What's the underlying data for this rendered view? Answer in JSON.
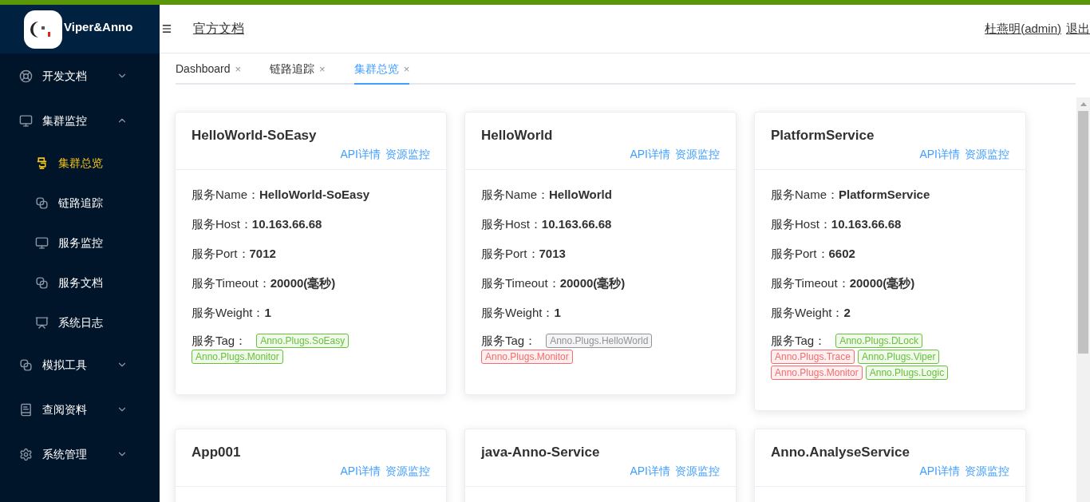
{
  "brand": {
    "name": "Viper&Anno"
  },
  "header": {
    "doc_link": "官方文档",
    "user": "杜燕明(admin)",
    "logout": "退出"
  },
  "sidebar": {
    "items": [
      {
        "label": "开发文档",
        "kind": "lifebuoy",
        "expanded": false,
        "selected": false
      },
      {
        "label": "集群监控",
        "kind": "monitor",
        "expanded": true,
        "selected": false,
        "children": [
          {
            "label": "集群总览",
            "kind": "cluster",
            "selected": true
          },
          {
            "label": "链路追踪",
            "kind": "link",
            "selected": false
          },
          {
            "label": "服务监控",
            "kind": "monitor",
            "selected": false
          },
          {
            "label": "服务文档",
            "kind": "link",
            "selected": false
          },
          {
            "label": "系统日志",
            "kind": "board",
            "selected": false
          }
        ]
      },
      {
        "label": "模拟工具",
        "kind": "link",
        "expanded": false,
        "selected": false
      },
      {
        "label": "查阅资料",
        "kind": "book",
        "expanded": false,
        "selected": false
      },
      {
        "label": "系统管理",
        "kind": "gear",
        "expanded": false,
        "selected": false
      }
    ]
  },
  "tabs": [
    {
      "label": "Dashboard",
      "close": "×",
      "selected": false
    },
    {
      "label": "链路追踪",
      "close": "×",
      "selected": false
    },
    {
      "label": "集群总览",
      "close": "×",
      "selected": true
    }
  ],
  "cards": [
    {
      "title": "HelloWorld-SoEasy",
      "links": [
        "API详情",
        "资源监控"
      ],
      "fields": [
        {
          "label": "服务Name：",
          "value": "HelloWorld-SoEasy"
        },
        {
          "label": "服务Host：",
          "value": "10.163.66.68"
        },
        {
          "label": "服务Port：",
          "value": "7012"
        },
        {
          "label": "服务Timeout：",
          "value": "20000(毫秒)"
        },
        {
          "label": "服务Weight：",
          "value": "1"
        }
      ],
      "tag_label": "服务Tag：",
      "tags": [
        {
          "text": "Anno.Plugs.SoEasy",
          "kind": "success"
        },
        {
          "text": "Anno.Plugs.Monitor",
          "kind": "success"
        }
      ]
    },
    {
      "title": "HelloWorld",
      "links": [
        "API详情",
        "资源监控"
      ],
      "fields": [
        {
          "label": "服务Name：",
          "value": "HelloWorld"
        },
        {
          "label": "服务Host：",
          "value": "10.163.66.68"
        },
        {
          "label": "服务Port：",
          "value": "7013"
        },
        {
          "label": "服务Timeout：",
          "value": "20000(毫秒)"
        },
        {
          "label": "服务Weight：",
          "value": "1"
        }
      ],
      "tag_label": "服务Tag：",
      "tags": [
        {
          "text": "Anno.Plugs.HelloWorld",
          "kind": "info"
        },
        {
          "text": "Anno.Plugs.Monitor",
          "kind": "danger"
        }
      ]
    },
    {
      "title": "PlatformService",
      "links": [
        "API详情",
        "资源监控"
      ],
      "fields": [
        {
          "label": "服务Name：",
          "value": "PlatformService"
        },
        {
          "label": "服务Host：",
          "value": "10.163.66.68"
        },
        {
          "label": "服务Port：",
          "value": "6602"
        },
        {
          "label": "服务Timeout：",
          "value": "20000(毫秒)"
        },
        {
          "label": "服务Weight：",
          "value": "2"
        }
      ],
      "tag_label": "服务Tag：",
      "tags": [
        {
          "text": "Anno.Plugs.DLock",
          "kind": "success"
        },
        {
          "text": "Anno.Plugs.Trace",
          "kind": "danger"
        },
        {
          "text": "Anno.Plugs.Viper",
          "kind": "success"
        },
        {
          "text": "Anno.Plugs.Monitor",
          "kind": "danger"
        },
        {
          "text": "Anno.Plugs.Logic",
          "kind": "success"
        }
      ]
    },
    {
      "title": "App001",
      "links": [
        "API详情",
        "资源监控"
      ]
    },
    {
      "title": "java-Anno-Service",
      "links": [
        "API详情",
        "资源监控"
      ]
    },
    {
      "title": "Anno.AnalyseService",
      "links": [
        "API详情",
        "资源监控"
      ]
    }
  ]
}
